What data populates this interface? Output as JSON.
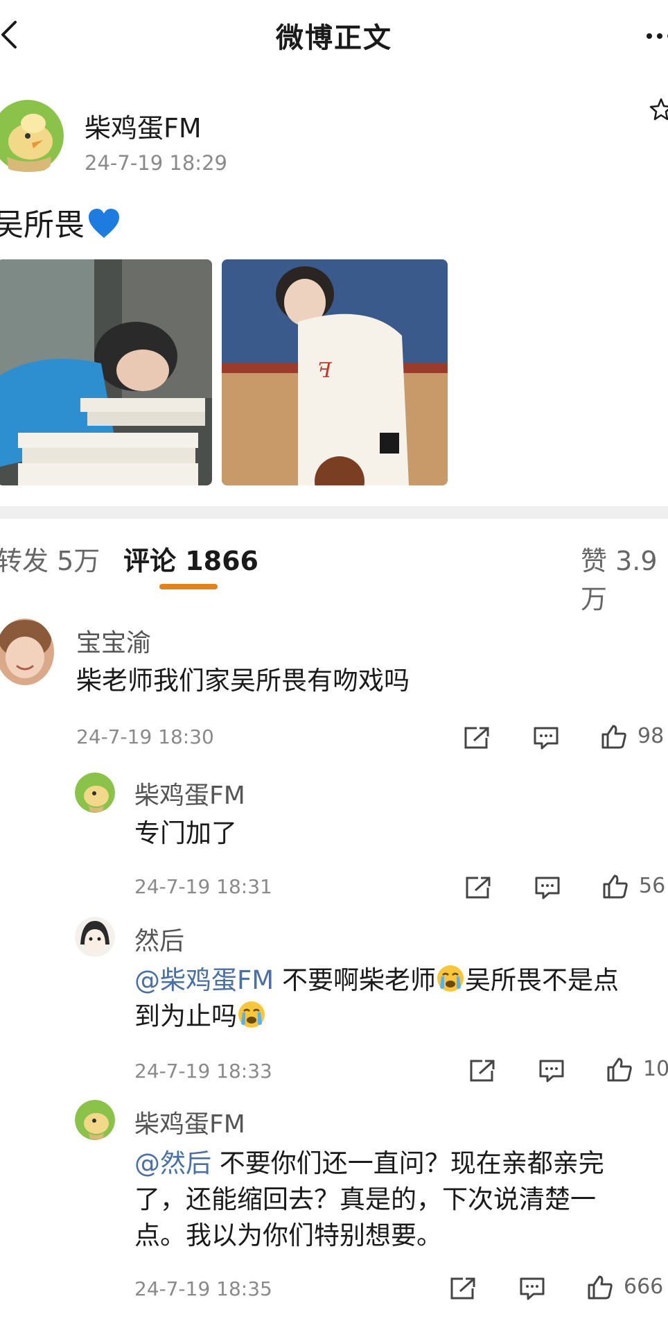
{
  "header": {
    "title": "微博正文"
  },
  "post": {
    "author": "柴鸡蛋FM",
    "time": "24-7-19 18:29",
    "text": "吴所畏"
  },
  "tabs": {
    "repost": "转发 5万",
    "comments": "评论 1866",
    "likes": "赞 3.9万"
  },
  "comments": [
    {
      "name": "宝宝渝",
      "text": "柴老师我们家吴所畏有吻戏吗",
      "time": "24-7-19 18:30",
      "likes": "98"
    }
  ],
  "replies": [
    {
      "name": "柴鸡蛋FM",
      "text": "专门加了",
      "time": "24-7-19 18:31",
      "likes": "56"
    },
    {
      "name": "然后",
      "mention": "@柴鸡蛋FM",
      "text_a": " 不要啊柴老师",
      "text_b": "吴所畏不是点",
      "text_c": "到为止吗",
      "time": "24-7-19 18:33",
      "likes": "10"
    },
    {
      "name": "柴鸡蛋FM",
      "mention": "@然后",
      "line1": " 不要你们还一直问？现在亲都亲完",
      "line2": "了，还能缩回去？真是的，下次说清楚一",
      "line3": "点。我以为你们特别想要。",
      "time": "24-7-19 18:35",
      "likes": "666"
    }
  ],
  "colors": {
    "accent": "#e0821f",
    "mention": "#4a6fa5",
    "heart": "#1e7be0"
  }
}
